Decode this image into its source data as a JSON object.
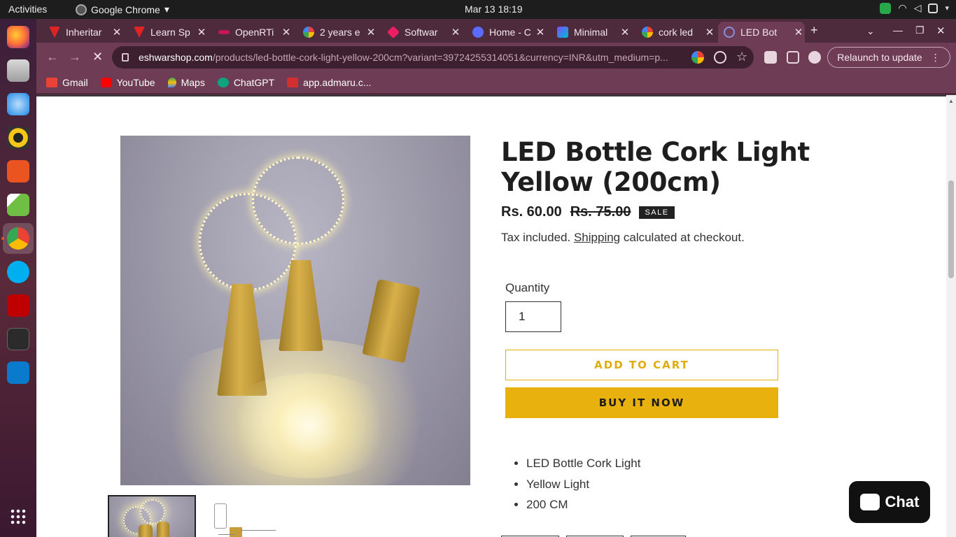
{
  "system": {
    "activities": "Activities",
    "app_name": "Google Chrome",
    "clock": "Mar 13  18:19"
  },
  "tabs": [
    {
      "title": "Inheritar",
      "color": "#e02424"
    },
    {
      "title": "Learn Sp",
      "color": "#e02424"
    },
    {
      "title": "OpenRTi",
      "color": "#c2185b"
    },
    {
      "title": "2 years e",
      "color": "#4285f4"
    },
    {
      "title": "Softwar",
      "color": "#e91e63"
    },
    {
      "title": "Home - C",
      "color": "#5b6bff"
    },
    {
      "title": "Minimal",
      "color": "#7c4dff"
    },
    {
      "title": "cork led",
      "color": "#4285f4"
    },
    {
      "title": "LED Bot",
      "color": "#8a8fd8"
    }
  ],
  "toolbar": {
    "url_domain": "eshwarshop.com",
    "url_path": "/products/led-bottle-cork-light-yellow-200cm?variant=39724255314051&currency=INR&utm_medium=p...",
    "relaunch": "Relaunch to update"
  },
  "bookmarks": [
    {
      "label": "Gmail",
      "color": "#ea4335"
    },
    {
      "label": "YouTube",
      "color": "#ff0000"
    },
    {
      "label": "Maps",
      "color": "#34a853"
    },
    {
      "label": "ChatGPT",
      "color": "#10a37f"
    },
    {
      "label": "app.admaru.c...",
      "color": "#d32f2f"
    }
  ],
  "product": {
    "title": "LED Bottle Cork Light Yellow (200cm)",
    "sale_price": "Rs. 60.00",
    "regular_price": "Rs. 75.00",
    "sale_badge": "SALE",
    "tax_prefix": "Tax included.",
    "tax_link": "Shipping",
    "tax_suffix": "calculated at checkout.",
    "quantity_label": "Quantity",
    "quantity_value": "1",
    "add_to_cart": "ADD TO CART",
    "buy_now": "BUY IT NOW",
    "features": [
      "LED Bottle Cork Light",
      "Yellow Light",
      "200 CM"
    ]
  },
  "chat_widget": {
    "label": "Chat"
  },
  "dock": [
    {
      "name": "firefox-icon",
      "color": "#ff7139"
    },
    {
      "name": "files-icon",
      "color": "#9e9e9e"
    },
    {
      "name": "thunderbird-icon",
      "color": "#1e88e5"
    },
    {
      "name": "rhythmbox-icon",
      "color": "#f5c518"
    },
    {
      "name": "app-center-icon",
      "color": "#e95420"
    },
    {
      "name": "image-viewer-icon",
      "color": "#6fbf44"
    },
    {
      "name": "chrome-icon",
      "color": "#4285f4"
    },
    {
      "name": "skype-icon",
      "color": "#00aff0"
    },
    {
      "name": "filezilla-icon",
      "color": "#bf0000"
    },
    {
      "name": "terminal-icon",
      "color": "#2b2b2b"
    },
    {
      "name": "vscode-icon",
      "color": "#0a7acc"
    }
  ]
}
